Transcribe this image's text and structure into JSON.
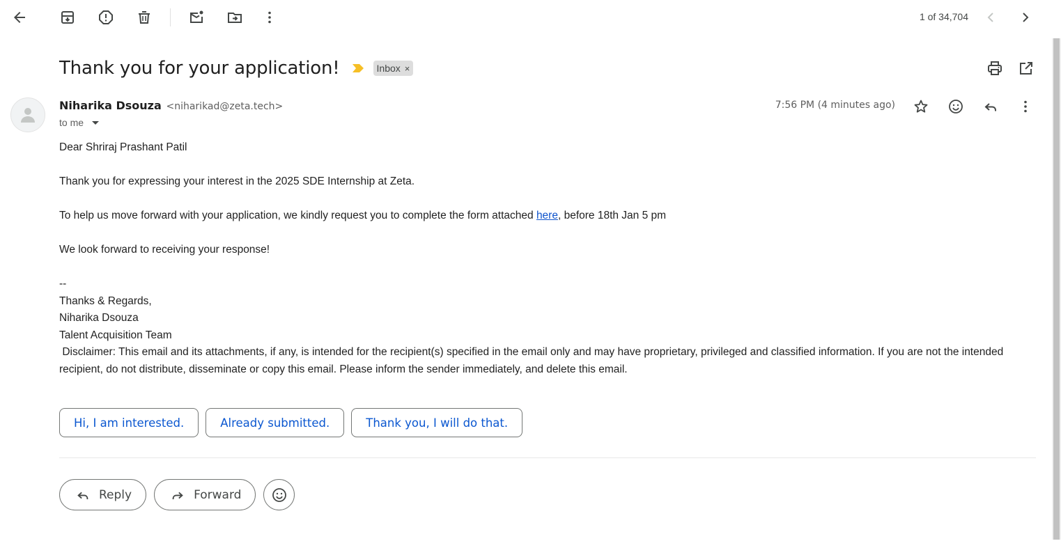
{
  "toolbar": {
    "pager_text": "1 of 34,704"
  },
  "email": {
    "subject": "Thank you for your application!",
    "label": "Inbox",
    "label_remove": "×",
    "sender_name": "Niharika Dsouza",
    "sender_email": "<niharikad@zeta.tech>",
    "to_text": "to me",
    "timestamp": "7:56 PM (4 minutes ago)",
    "body": {
      "greeting": "Dear Shriraj Prashant Patil",
      "para1": "Thank you for expressing your interest in the 2025 SDE Internship at Zeta.",
      "para2_before": "To help us move forward with your application, we kindly request you to complete the form attached ",
      "para2_link": "here",
      "para2_after": ", before 18th Jan 5 pm",
      "para3": "We look forward to receiving your response!",
      "sig_dash": "--",
      "sig_regards": "Thanks & Regards,",
      "sig_name": "Niharika Dsouza",
      "sig_team": "Talent Acquisition Team",
      "disclaimer": " Disclaimer: This email and its attachments, if any, is intended for the recipient(s) specified in the email only and may have proprietary, privileged and classified information. If you are not the intended recipient, do not distribute, disseminate or copy this email. Please inform the sender immediately, and delete this email."
    }
  },
  "smart_replies": [
    "Hi, I am interested.",
    "Already submitted.",
    "Thank you, I will do that."
  ],
  "actions": {
    "reply": "Reply",
    "forward": "Forward"
  },
  "colors": {
    "link": "#1155cc",
    "smart_reply_text": "#0b57d0",
    "importance_marker": "#f6bf26",
    "label_chip_bg": "#dddddd"
  }
}
